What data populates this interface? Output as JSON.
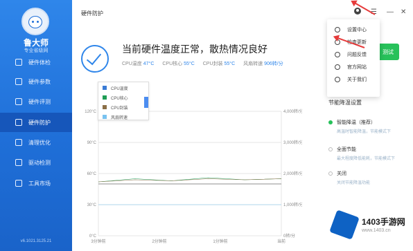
{
  "app": {
    "name": "鲁大师",
    "subtitle": "专业省级网",
    "version": "v6.1021.3125.21"
  },
  "sidebar": {
    "items": [
      {
        "label": "硬件体检"
      },
      {
        "label": "硬件参数"
      },
      {
        "label": "硬件评测"
      },
      {
        "label": "硬件防护"
      },
      {
        "label": "清理优化"
      },
      {
        "label": "驱动检测"
      },
      {
        "label": "工具市场"
      }
    ]
  },
  "header": {
    "title": "硬件防护"
  },
  "status": {
    "headline": "当前硬件温度正常，散热情况良好",
    "metrics": [
      {
        "label": "CPU温度",
        "value": "47°C"
      },
      {
        "label": "CPU核心",
        "value": "55°C"
      },
      {
        "label": "CPU封装",
        "value": "55°C"
      },
      {
        "label": "风扇转速",
        "value": "906转/分"
      }
    ]
  },
  "chart_data": {
    "type": "line",
    "left_ticks": [
      "120°C",
      "90°C",
      "60°C",
      "30°C",
      "0°C"
    ],
    "right_ticks": [
      "4,000转/分",
      "3,000转/分",
      "2,000转/分",
      "1,000转/分",
      "0转/分"
    ],
    "x_ticks": [
      "3分钟前",
      "2分钟前",
      "1分钟前",
      "当前"
    ],
    "legend": [
      {
        "name": "CPU温度",
        "color": "#3a7bd5"
      },
      {
        "name": "CPU核心",
        "color": "#1f9d55"
      },
      {
        "name": "CPU封装",
        "color": "#8b6f47"
      },
      {
        "name": "风扇转速",
        "color": "#79c2f0"
      }
    ],
    "series": [
      {
        "name": "CPU温度",
        "values": [
          50,
          50,
          50,
          50,
          50,
          50
        ]
      },
      {
        "name": "CPU核心",
        "values": [
          52,
          55,
          53,
          56,
          54,
          55
        ]
      },
      {
        "name": "CPU封装",
        "values": [
          52,
          54,
          53,
          55,
          54,
          55
        ]
      },
      {
        "name": "风扇转速",
        "values": [
          1000,
          1000,
          1000,
          1000,
          1000,
          1000
        ]
      }
    ],
    "ylim_left": [
      0,
      120
    ],
    "ylim_right": [
      0,
      4000
    ],
    "colors": {
      "grid": "#e6e6e6",
      "line": "#666"
    }
  },
  "menu": {
    "items": [
      {
        "label": "设置中心"
      },
      {
        "label": "检查更新"
      },
      {
        "label": "问题反馈"
      },
      {
        "label": "官方网站"
      },
      {
        "label": "关于我们"
      }
    ]
  },
  "right_panel": {
    "cta_label": "测试",
    "energy_title": "节能降温设置",
    "options": [
      {
        "title": "智能降温（推荐）",
        "desc": "高温时智能降温，节能模式下",
        "selected": true
      },
      {
        "title": "全面节能",
        "desc": "最大程度降低能耗，节能模式下",
        "selected": false
      },
      {
        "title": "关闭",
        "desc": "关闭节能降温功能",
        "selected": false
      }
    ]
  },
  "watermark": {
    "text": "1403手游网",
    "url": "www.1403.cn"
  },
  "colors": {
    "sidebar": "#1f6fd8",
    "active": "#1656ba",
    "accent": "#2f86ea",
    "cta": "#27c15a",
    "arrow": "#e63b3b"
  }
}
